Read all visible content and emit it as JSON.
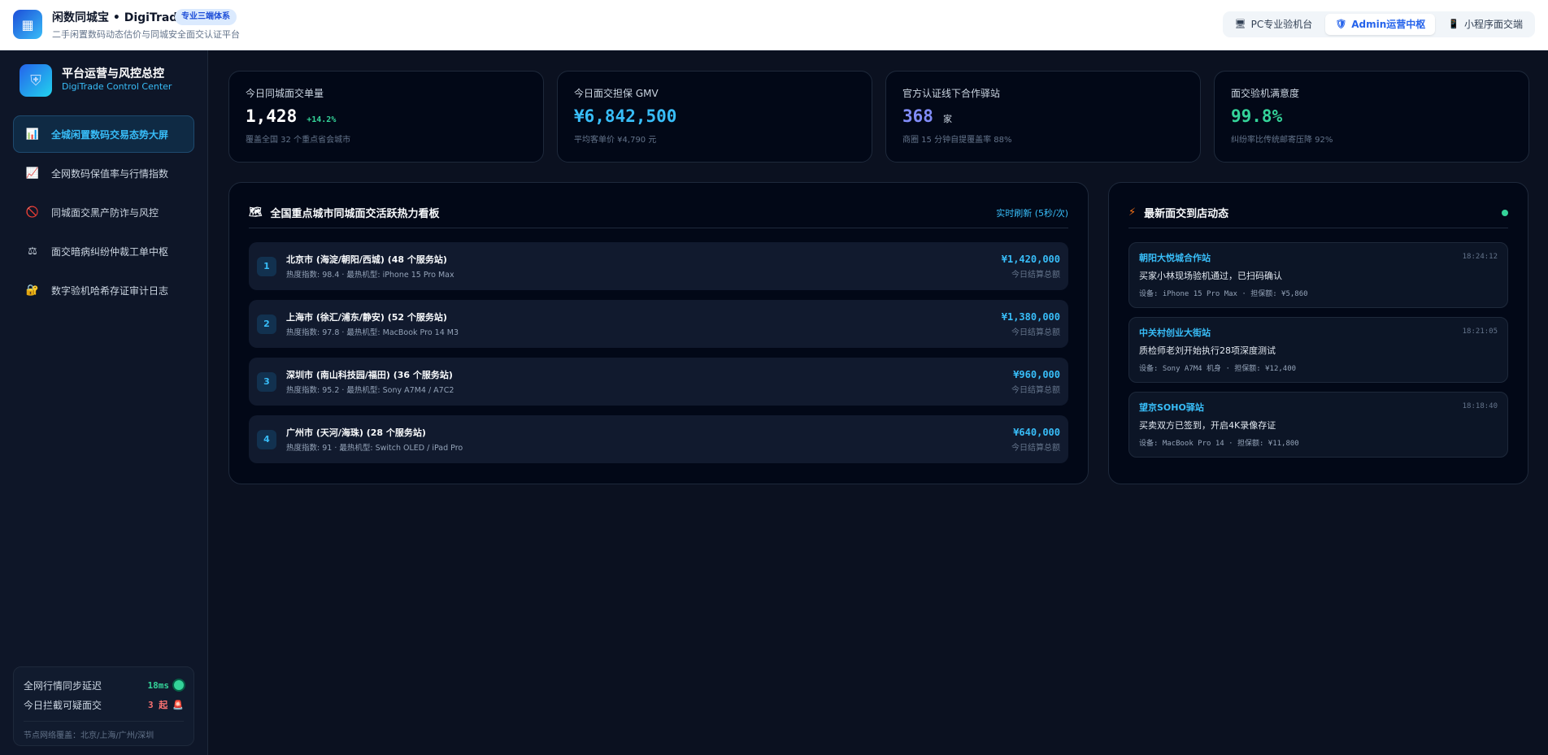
{
  "header": {
    "logo_icon": "calculator-icon",
    "title": "闲数同城宝 • DigiTrade",
    "badge": "专业三端体系",
    "subtitle": "二手闲置数码动态估价与同城安全面交认证平台",
    "portals": [
      {
        "label": "PC专业验机台",
        "icon": "monitor-icon",
        "active": false
      },
      {
        "label": "Admin运营中枢",
        "icon": "shield-icon",
        "active": true
      },
      {
        "label": "小程序面交端",
        "icon": "phone-icon",
        "active": false
      }
    ]
  },
  "sidebar": {
    "brand_title": "平台运营与风控总控",
    "brand_subtitle": "DigiTrade Control Center",
    "items": [
      {
        "label": "全城闲置数码交易态势大屏",
        "icon": "bar-chart-icon",
        "active": true
      },
      {
        "label": "全网数码保值率与行情指数",
        "icon": "trend-chart-icon",
        "active": false
      },
      {
        "label": "同城面交黑产防诈与风控",
        "icon": "no-entry-icon",
        "active": false
      },
      {
        "label": "面交暗病纠纷仲裁工单中枢",
        "icon": "scales-icon",
        "active": false
      },
      {
        "label": "数字验机哈希存证审计日志",
        "icon": "lock-icon",
        "active": false
      }
    ],
    "sync": {
      "latency_label": "全网行情同步延迟",
      "latency_value": "18ms",
      "blocked_label": "今日拦截可疑面交",
      "blocked_value": "3 起",
      "node_text": "节点网络覆盖：北京/上海/广州/深圳"
    }
  },
  "kpis": [
    {
      "label": "今日同城面交单量",
      "value": "1,428",
      "delta": "+14.2%",
      "unit": "",
      "note": "覆盖全国 32 个重点省会城市",
      "color": "#ffffff"
    },
    {
      "label": "今日面交担保 GMV",
      "value": "¥6,842,500",
      "delta": "",
      "unit": "",
      "note": "平均客单价 ¥4,790 元",
      "color": "#38bdf8"
    },
    {
      "label": "官方认证线下合作驿站",
      "value": "368",
      "delta": "",
      "unit": "家",
      "note": "商圈 15 分钟自提覆盖率 88%",
      "color": "#818cf8"
    },
    {
      "label": "面交验机满意度",
      "value": "99.8%",
      "delta": "",
      "unit": "",
      "note": "纠纷率比传统邮寄压降 92%",
      "color": "#34d399"
    }
  ],
  "heatmap_panel": {
    "title": "全国重点城市同城面交活跃热力看板",
    "icon": "map-icon",
    "refresh": "实时刷新 (5秒/次)",
    "cities": [
      {
        "rank": "1",
        "name": "北京市 (海淀/朝阳/西城) (48 个服务站)",
        "meta": "热度指数: 98.4 · 最热机型: iPhone 15 Pro Max",
        "amount": "¥1,420,000",
        "amount_label": "今日结算总额"
      },
      {
        "rank": "2",
        "name": "上海市 (徐汇/浦东/静安) (52 个服务站)",
        "meta": "热度指数: 97.8 · 最热机型: MacBook Pro 14 M3",
        "amount": "¥1,380,000",
        "amount_label": "今日结算总额"
      },
      {
        "rank": "3",
        "name": "深圳市 (南山科技园/福田) (36 个服务站)",
        "meta": "热度指数: 95.2 · 最热机型: Sony A7M4 / A7C2",
        "amount": "¥960,000",
        "amount_label": "今日结算总额"
      },
      {
        "rank": "4",
        "name": "广州市 (天河/海珠) (28 个服务站)",
        "meta": "热度指数: 91 · 最热机型: Switch OLED / iPad Pro",
        "amount": "¥640,000",
        "amount_label": "今日结算总额"
      }
    ]
  },
  "feed_panel": {
    "title": "最新面交到店动态",
    "icon": "lightning-icon",
    "events": [
      {
        "station": "朝阳大悦城合作站",
        "time": "18:24:12",
        "message": "买家小林现场验机通过，已扫码确认",
        "device": "设备: iPhone 15 Pro Max · 担保额: ¥5,860"
      },
      {
        "station": "中关村创业大街站",
        "time": "18:21:05",
        "message": "质检师老刘开始执行28项深度测试",
        "device": "设备: Sony A7M4 机身 · 担保额: ¥12,400"
      },
      {
        "station": "望京SOHO驿站",
        "time": "18:18:40",
        "message": "买卖双方已签到，开启4K录像存证",
        "device": "设备: MacBook Pro 14 · 担保额: ¥11,800"
      }
    ]
  }
}
